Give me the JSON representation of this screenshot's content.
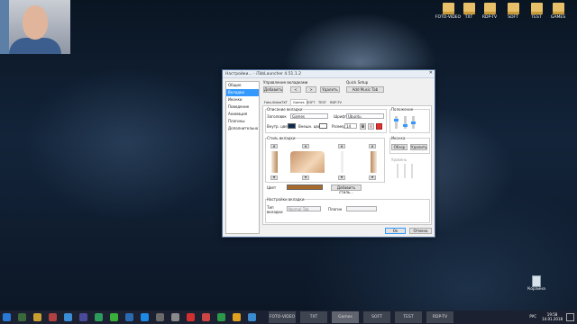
{
  "desktop": {
    "icons": [
      {
        "label": "FOTO-VIDEO"
      },
      {
        "label": "TXT"
      },
      {
        "label": "RDP-TV"
      },
      {
        "label": "SOFT"
      },
      {
        "label": "TEST"
      },
      {
        "label": "GAMES"
      }
    ],
    "recycle_bin": "Корзина"
  },
  "dialog": {
    "title": "Настройки... - iTabLauncher 4.51.1.2",
    "close": "✕",
    "nav": [
      "Общие",
      "Вкладки",
      "Иконки",
      "Поведение",
      "Анимация",
      "Плагины",
      "Дополнительно"
    ],
    "manage_label": "Управление вкладками",
    "add_btn": "Добавить",
    "left_btn": "<",
    "right_btn": ">",
    "delete_btn": "Удалить",
    "quick_label": "Quick Setup",
    "add_music_btn": "Add Music Tab",
    "tabs": [
      "Foto-Video",
      "TXT",
      "Games",
      "SOFT",
      "TEST",
      "RDP-TV"
    ],
    "selected_tab": "Games",
    "desc_label": "Описание вкладки",
    "title_label": "Заголовок",
    "title_value": "Games",
    "font_label": "Шрифт",
    "font_value": "Ubuntu",
    "inner_color_label": "Внутр. цвет",
    "outer_color_label": "Внешн. цвет",
    "size_label": "Размер",
    "size_value": "14",
    "bold": "B",
    "italic": "I",
    "position_label": "Положение",
    "style_label": "Стиль вкладки",
    "color_label": "Цвет",
    "add_style_btn": "Добавить стиль...",
    "icon_label": "Иконка",
    "browse_btn": "Обзор",
    "icon_delete_btn": "Удалить",
    "align_label": "Уровень",
    "settings_label": "Настройки вкладки",
    "type_label": "Тип вкладки",
    "type_value": "Normal Tab",
    "plugin_label": "Плагин",
    "ok_btn": "Ок",
    "cancel_btn": "Отмена"
  },
  "taskbar": {
    "tabs": [
      "FOTO-VIDEO",
      "TXT",
      "Games",
      "SOFT",
      "TEST",
      "RDP-TV"
    ],
    "lang": "РУС",
    "time": "19:58",
    "date": "14.01.2018"
  },
  "colors": {
    "accent": "#3399ff",
    "tab_style": "#a86a2c",
    "inner_color": "#0d2a4a"
  }
}
